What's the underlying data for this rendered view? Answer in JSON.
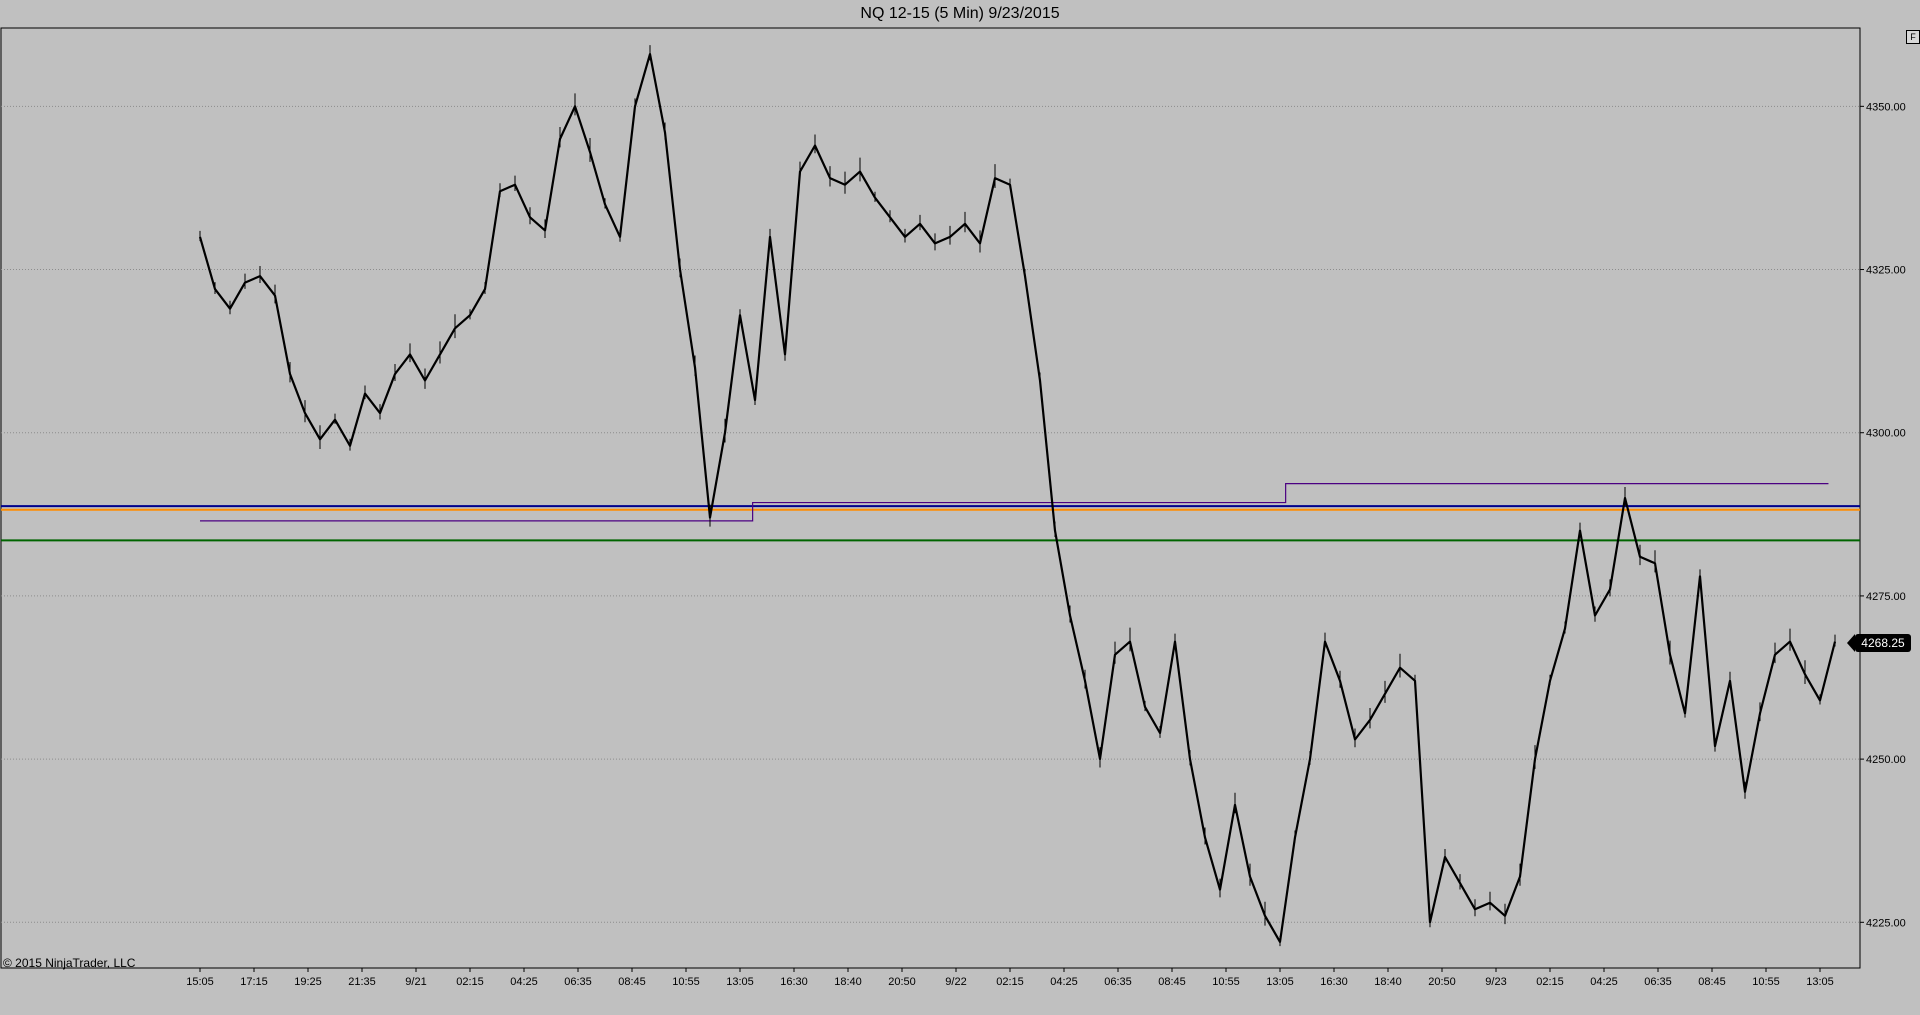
{
  "window": {
    "title": "NQ 12-15 (5 Min)  9/23/2015",
    "copyright": "© 2015 NinjaTrader, LLC",
    "panel_button": "F"
  },
  "colors": {
    "background": "#c0c0c0",
    "price_line": "#000000",
    "level_blue": "#00008b",
    "level_orange": "#ff8c00",
    "level_green": "#006400",
    "step_line": "#4b0082",
    "grid": "#8c8c8c",
    "last_price_bg": "#000000"
  },
  "chart_data": {
    "type": "line",
    "title": "NQ 12-15 (5 Min)  9/23/2015",
    "ylim": [
      4218,
      4362
    ],
    "y_ticks": [
      4225,
      4250,
      4275,
      4300,
      4325,
      4350
    ],
    "y_tick_labels": [
      "4225.00",
      "4250.00",
      "4275.00",
      "4300.00",
      "4325.00",
      "4350.00"
    ],
    "x_tick_labels": [
      "15:05",
      "17:15",
      "19:25",
      "21:35",
      "9/21",
      "02:15",
      "04:25",
      "06:35",
      "08:45",
      "10:55",
      "13:05",
      "16:30",
      "18:40",
      "20:50",
      "9/22",
      "02:15",
      "04:25",
      "06:35",
      "08:45",
      "10:55",
      "13:05",
      "16:30",
      "18:40",
      "20:50",
      "9/23",
      "02:15",
      "04:25",
      "06:35",
      "08:45",
      "10:55",
      "13:05"
    ],
    "grid": true,
    "last_price": "4268.25",
    "series": [
      {
        "values": [
          4330,
          4322,
          4319,
          4323,
          4324,
          4321,
          4309,
          4303,
          4299,
          4302,
          4298,
          4306,
          4303,
          4309,
          4312,
          4308,
          4312,
          4316,
          4318,
          4322,
          4337,
          4338,
          4333,
          4331,
          4345,
          4350,
          4343,
          4335,
          4330,
          4350,
          4358,
          4346,
          4325,
          4310,
          4287,
          4300,
          4318,
          4305,
          4330,
          4312,
          4340,
          4344,
          4339,
          4338,
          4340,
          4336,
          4333,
          4330,
          4332,
          4329,
          4330,
          4332,
          4329,
          4339,
          4338,
          4324,
          4308,
          4285,
          4272,
          4262,
          4250,
          4266,
          4268,
          4258,
          4254,
          4268,
          4250,
          4238,
          4230,
          4243,
          4232,
          4226,
          4222,
          4238,
          4250,
          4268,
          4262,
          4253,
          4256,
          4260,
          4264,
          4262,
          4225,
          4235,
          4231,
          4227,
          4228,
          4226,
          4232,
          4250,
          4262,
          4270,
          4285,
          4272,
          4276,
          4290,
          4281,
          4280,
          4266,
          4257,
          4278,
          4252,
          4262,
          4245,
          4257,
          4266,
          4268,
          4263,
          4259,
          4268
        ]
      }
    ],
    "levels": [
      {
        "name": "blue",
        "value": 4288.75
      },
      {
        "name": "orange",
        "value": 4288.2
      },
      {
        "name": "green",
        "value": 4283.5
      }
    ],
    "step_line": [
      {
        "x_from": 0,
        "x_to": 33.8,
        "value": 4286.5
      },
      {
        "x_from": 33.8,
        "x_to": 66.4,
        "value": 4289.3
      },
      {
        "x_from": 66.4,
        "x_to": 99.6,
        "value": 4292.2
      }
    ]
  }
}
